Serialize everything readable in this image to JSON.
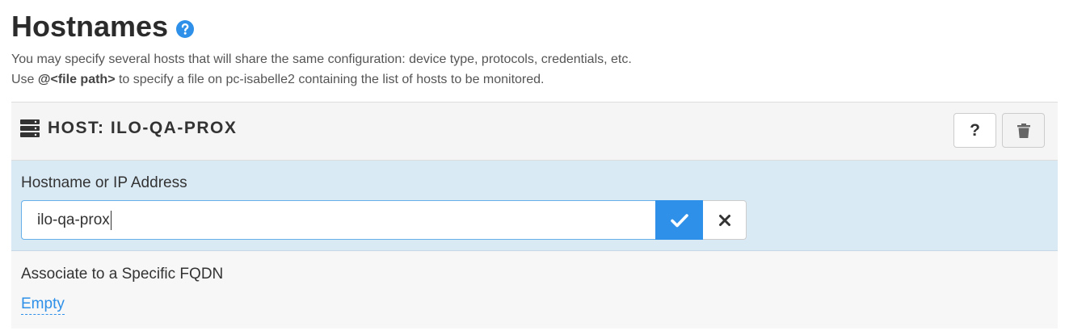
{
  "page": {
    "title": "Hostnames",
    "help_icon": "question-circle-icon",
    "description_line1": "You may specify several hosts that will share the same configuration: device type, protocols, credentials, etc.",
    "description_line2_prefix": "Use ",
    "description_line2_bold": "@<file path>",
    "description_line2_suffix": " to specify a file on pc-isabelle2 containing the list of hosts to be monitored."
  },
  "host_panel": {
    "icon": "server-icon",
    "title": "HOST: ILO-QA-PROX",
    "help_button_label": "?",
    "delete_icon": "trash-icon",
    "hostname_field": {
      "label": "Hostname or IP Address",
      "value": "ilo-qa-prox",
      "confirm_icon": "check-icon",
      "cancel_icon": "close-icon"
    },
    "fqdn_field": {
      "label": "Associate to a Specific FQDN",
      "value": "Empty"
    }
  },
  "colors": {
    "accent": "#2e90e8",
    "edit_row_bg": "#d9eaf5",
    "panel_bg": "#f5f5f5"
  }
}
